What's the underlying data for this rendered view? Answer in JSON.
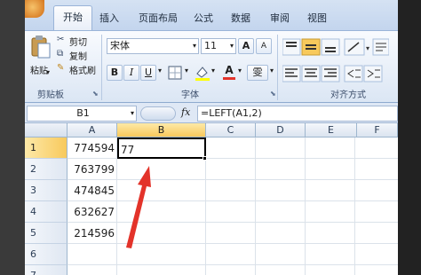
{
  "tabs": [
    "开始",
    "插入",
    "页面布局",
    "公式",
    "数据",
    "审阅",
    "视图"
  ],
  "clipboard": {
    "paste": "粘贴",
    "cut": "剪切",
    "copy": "复制",
    "format_painter": "格式刷",
    "group_label": "剪贴板"
  },
  "font": {
    "name": "宋体",
    "size": "11",
    "bold": "B",
    "italic": "I",
    "underline": "U",
    "font_color": "A",
    "wen": "雯",
    "group_label": "字体"
  },
  "alignment": {
    "group_label": "对齐方式"
  },
  "formula_bar": {
    "name_box": "B1",
    "fx": "fx",
    "formula": "=LEFT(A1,2)"
  },
  "columns": [
    "A",
    "B",
    "C",
    "D",
    "E",
    "F"
  ],
  "rows": [
    {
      "num": "1",
      "a": "774594",
      "b": "77"
    },
    {
      "num": "2",
      "a": "763799",
      "b": ""
    },
    {
      "num": "3",
      "a": "474845",
      "b": ""
    },
    {
      "num": "4",
      "a": "632627",
      "b": ""
    },
    {
      "num": "5",
      "a": "214596",
      "b": ""
    },
    {
      "num": "6",
      "a": "",
      "b": ""
    },
    {
      "num": "7",
      "a": "",
      "b": ""
    }
  ],
  "colors": {
    "arrow": "#e3332a",
    "selected_header": "#f8c95c"
  }
}
